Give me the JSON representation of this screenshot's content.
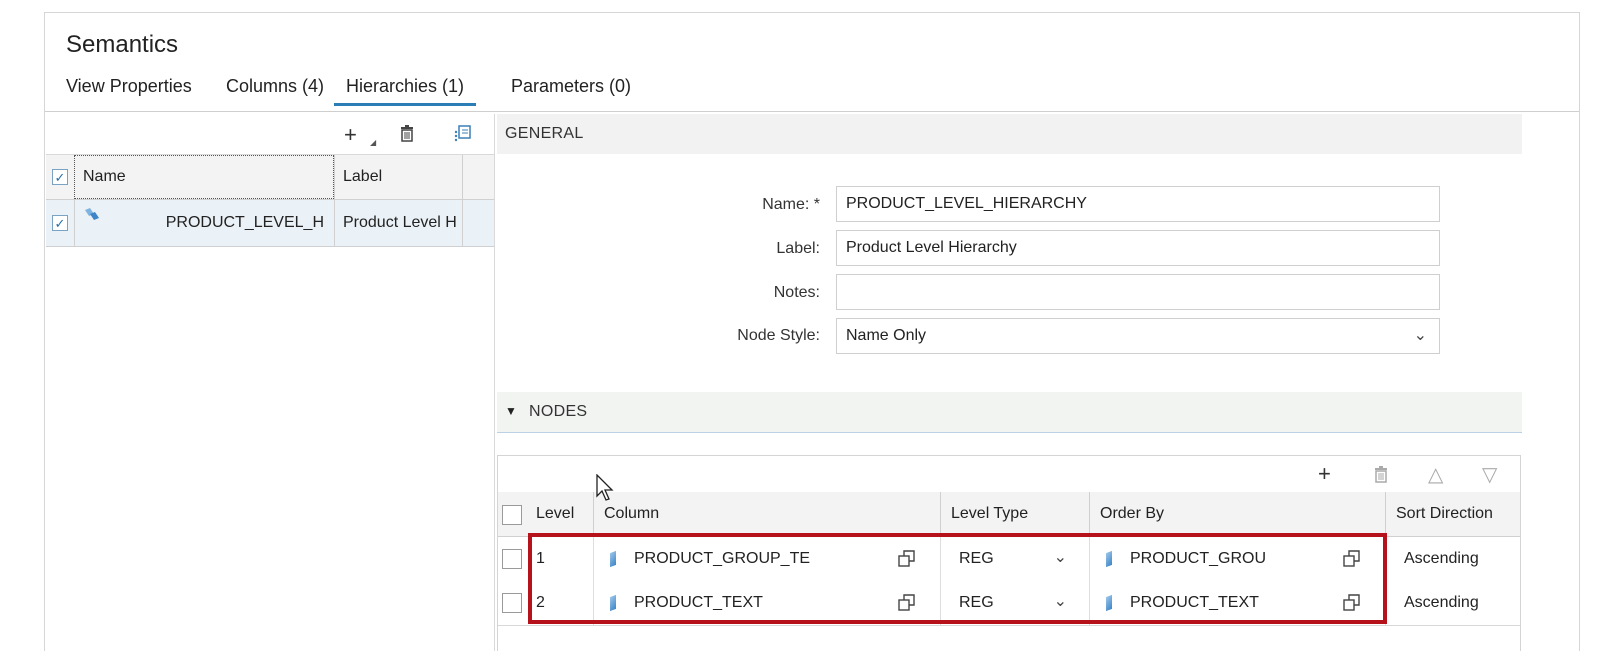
{
  "header": {
    "title": "Semantics",
    "tabs": [
      {
        "label": "View Properties"
      },
      {
        "label": "Columns (4)"
      },
      {
        "label": "Hierarchies (1)"
      },
      {
        "label": "Parameters (0)"
      }
    ],
    "active_tab": "Hierarchies (1)"
  },
  "hierarchy_list": {
    "toolbar_icons": [
      "add-icon",
      "delete-icon",
      "find-icon"
    ],
    "columns": [
      "Name",
      "Label"
    ],
    "rows": [
      {
        "name": "PRODUCT_LEVEL_H",
        "label": "Product Level H",
        "checked": true
      }
    ],
    "header_checked": true
  },
  "general": {
    "section_title": "GENERAL",
    "name_label": "Name: *",
    "name_value": "PRODUCT_LEVEL_HIERARCHY",
    "label_label": "Label:",
    "label_value": "Product Level Hierarchy",
    "notes_label": "Notes:",
    "notes_value": "",
    "node_style_label": "Node Style:",
    "node_style_value": "Name Only"
  },
  "nodes": {
    "section_title": "NODES",
    "toolbar_icons": [
      "add-icon",
      "delete-icon",
      "move-up-icon",
      "move-down-icon"
    ],
    "columns": [
      "Level",
      "Column",
      "Level Type",
      "Order By",
      "Sort Direction"
    ],
    "rows": [
      {
        "level": "1",
        "column": "PRODUCT_GROUP_TE",
        "level_type": "REG",
        "order_by": "PRODUCT_GROU",
        "sort_direction": "Ascending"
      },
      {
        "level": "2",
        "column": "PRODUCT_TEXT",
        "level_type": "REG",
        "order_by": "PRODUCT_TEXT",
        "sort_direction": "Ascending"
      }
    ]
  },
  "colors": {
    "accent": "#2a7db5",
    "highlight_border": "#b5121b"
  }
}
